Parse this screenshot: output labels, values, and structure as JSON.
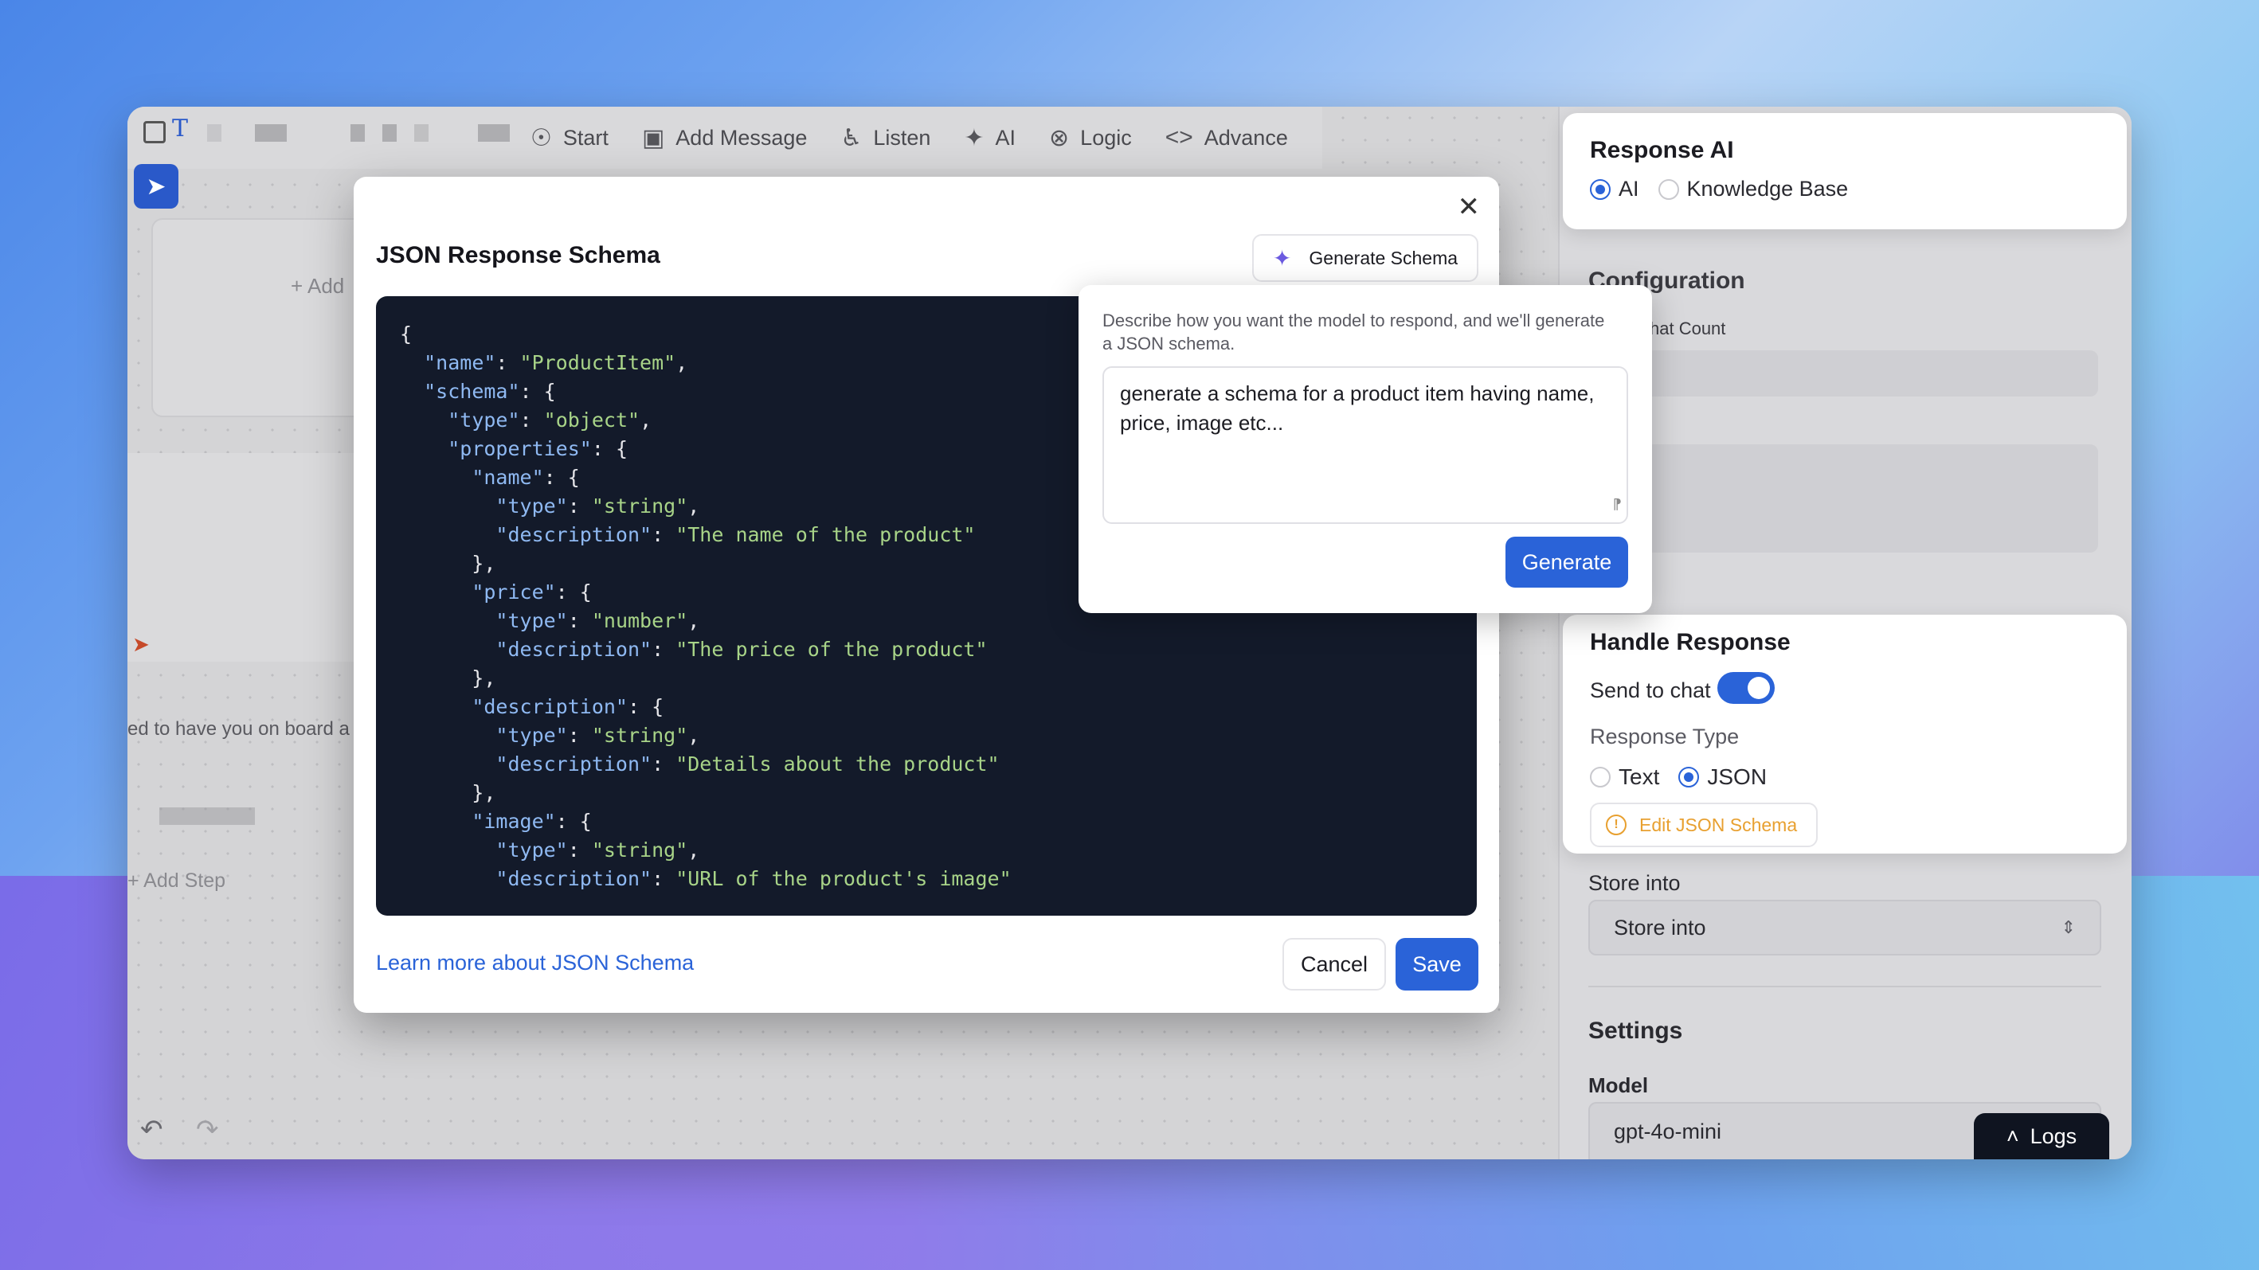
{
  "toolbar": {
    "items": [
      {
        "label": "Start",
        "icon": "start-circle-icon"
      },
      {
        "label": "Add Message",
        "icon": "message-plus-icon"
      },
      {
        "label": "Listen",
        "icon": "ear-icon"
      },
      {
        "label": "AI",
        "icon": "ai-sparkle-icon"
      },
      {
        "label": "Logic",
        "icon": "logic-x-icon"
      },
      {
        "label": "Advance",
        "icon": "code-brackets-icon"
      }
    ]
  },
  "canvas": {
    "add_label": "Add",
    "message_snippet": "ed to have you on board a",
    "add_step": "Add Step"
  },
  "modal": {
    "title": "JSON Response Schema",
    "generate_schema_label": "Generate Schema",
    "code_lines": [
      [
        [
          "p",
          "{"
        ]
      ],
      [
        [
          "p",
          "  "
        ],
        [
          "k",
          "\"name\""
        ],
        [
          "p",
          ": "
        ],
        [
          "s",
          "\"ProductItem\""
        ],
        [
          "p",
          ","
        ]
      ],
      [
        [
          "p",
          "  "
        ],
        [
          "k",
          "\"schema\""
        ],
        [
          "p",
          ": {"
        ]
      ],
      [
        [
          "p",
          "    "
        ],
        [
          "k",
          "\"type\""
        ],
        [
          "p",
          ": "
        ],
        [
          "s",
          "\"object\""
        ],
        [
          "p",
          ","
        ]
      ],
      [
        [
          "p",
          "    "
        ],
        [
          "k",
          "\"properties\""
        ],
        [
          "p",
          ": {"
        ]
      ],
      [
        [
          "p",
          "      "
        ],
        [
          "k",
          "\"name\""
        ],
        [
          "p",
          ": {"
        ]
      ],
      [
        [
          "p",
          "        "
        ],
        [
          "k",
          "\"type\""
        ],
        [
          "p",
          ": "
        ],
        [
          "s",
          "\"string\""
        ],
        [
          "p",
          ","
        ]
      ],
      [
        [
          "p",
          "        "
        ],
        [
          "k",
          "\"description\""
        ],
        [
          "p",
          ": "
        ],
        [
          "s",
          "\"The name of the product\""
        ]
      ],
      [
        [
          "p",
          "      },"
        ]
      ],
      [
        [
          "p",
          "      "
        ],
        [
          "k",
          "\"price\""
        ],
        [
          "p",
          ": {"
        ]
      ],
      [
        [
          "p",
          "        "
        ],
        [
          "k",
          "\"type\""
        ],
        [
          "p",
          ": "
        ],
        [
          "s",
          "\"number\""
        ],
        [
          "p",
          ","
        ]
      ],
      [
        [
          "p",
          "        "
        ],
        [
          "k",
          "\"description\""
        ],
        [
          "p",
          ": "
        ],
        [
          "s",
          "\"The price of the product\""
        ]
      ],
      [
        [
          "p",
          "      },"
        ]
      ],
      [
        [
          "p",
          "      "
        ],
        [
          "k",
          "\"description\""
        ],
        [
          "p",
          ": {"
        ]
      ],
      [
        [
          "p",
          "        "
        ],
        [
          "k",
          "\"type\""
        ],
        [
          "p",
          ": "
        ],
        [
          "s",
          "\"string\""
        ],
        [
          "p",
          ","
        ]
      ],
      [
        [
          "p",
          "        "
        ],
        [
          "k",
          "\"description\""
        ],
        [
          "p",
          ": "
        ],
        [
          "s",
          "\"Details about the product\""
        ]
      ],
      [
        [
          "p",
          "      },"
        ]
      ],
      [
        [
          "p",
          "      "
        ],
        [
          "k",
          "\"image\""
        ],
        [
          "p",
          ": {"
        ]
      ],
      [
        [
          "p",
          "        "
        ],
        [
          "k",
          "\"type\""
        ],
        [
          "p",
          ": "
        ],
        [
          "s",
          "\"string\""
        ],
        [
          "p",
          ","
        ]
      ],
      [
        [
          "p",
          "        "
        ],
        [
          "k",
          "\"description\""
        ],
        [
          "p",
          ": "
        ],
        [
          "s",
          "\"URL of the product's image\""
        ]
      ]
    ],
    "learn_more": "Learn more about JSON Schema",
    "cancel_label": "Cancel",
    "save_label": "Save"
  },
  "generate_popover": {
    "description": "Describe how you want the model to respond, and we'll generate a JSON schema.",
    "prompt_value": "generate a schema for a product item having name, price, image etc...",
    "generate_label": "Generate"
  },
  "right_panel": {
    "response_ai": {
      "title": "Response AI",
      "options": [
        "AI",
        "Knowledge Base"
      ],
      "selected": "AI"
    },
    "configuration": {
      "title": "Configuration",
      "chat_count_label": "s Chat Count"
    },
    "handle_response": {
      "title": "Handle Response",
      "send_to_chat_label": "Send to chat",
      "send_to_chat": true,
      "response_type_label": "Response Type",
      "response_type_options": [
        "Text",
        "JSON"
      ],
      "response_type_selected": "JSON",
      "edit_schema_label": "Edit JSON Schema"
    },
    "store_into": {
      "label": "Store into",
      "value": "Store into"
    },
    "settings": {
      "title": "Settings",
      "model_label": "Model",
      "model_value": "gpt-4o-mini"
    },
    "logs_label": "Logs"
  },
  "colors": {
    "accent": "#2a63d8",
    "code_bg": "#131a2a",
    "code_key": "#8fb9f2",
    "code_string": "#a8d488",
    "warning": "#e8a030"
  }
}
